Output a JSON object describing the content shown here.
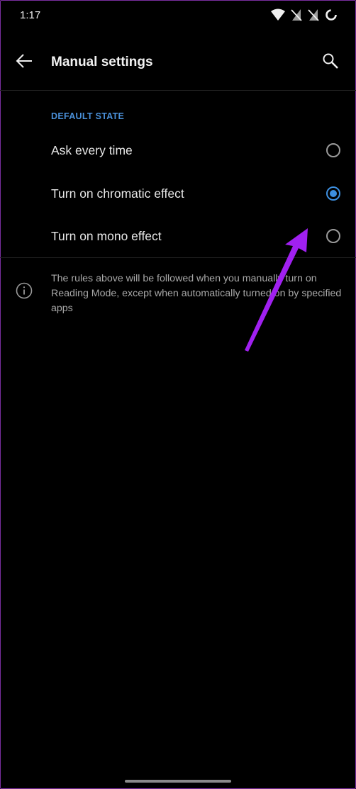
{
  "status_bar": {
    "time": "1:17",
    "icons": [
      "wifi-icon",
      "no-sim-icon",
      "no-sim-icon",
      "loading-icon"
    ]
  },
  "app_bar": {
    "title": "Manual settings",
    "back_icon": "back-arrow-icon",
    "search_icon": "search-icon"
  },
  "section": {
    "header": "DEFAULT STATE",
    "options": [
      {
        "label": "Ask every time",
        "selected": false
      },
      {
        "label": "Turn on chromatic effect",
        "selected": true
      },
      {
        "label": "Turn on mono effect",
        "selected": false
      }
    ]
  },
  "info": {
    "icon": "info-icon",
    "text": "The rules above will be followed when you manually turn on Reading Mode, except when automatically turned on by specified apps"
  },
  "annotation": {
    "arrow_color": "#a020f0"
  },
  "colors": {
    "accent": "#3d8fe0",
    "section_header": "#4a90d9",
    "background": "#000000"
  }
}
